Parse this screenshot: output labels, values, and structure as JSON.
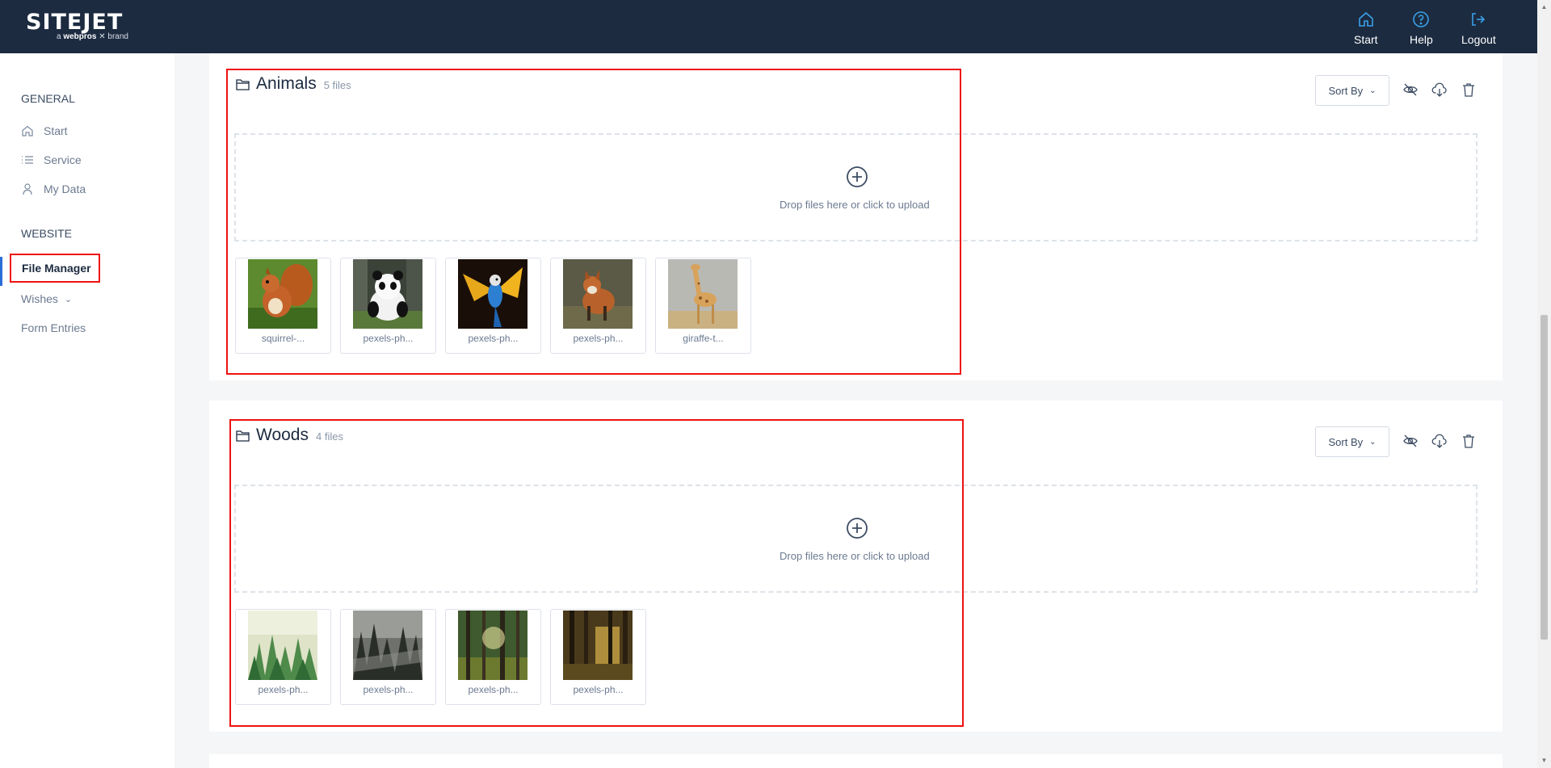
{
  "header": {
    "logo_text": "SITEJET",
    "logo_tag_prefix": "a",
    "logo_tag_brand": "webpros",
    "logo_tag_suffix": "brand",
    "nav": [
      {
        "label": "Start",
        "icon": "home-icon"
      },
      {
        "label": "Help",
        "icon": "question-circle-icon"
      },
      {
        "label": "Logout",
        "icon": "logout-icon"
      }
    ]
  },
  "sidebar": {
    "general_title": "GENERAL",
    "general_items": [
      {
        "label": "Start",
        "icon": "home-icon"
      },
      {
        "label": "Service",
        "icon": "list-icon"
      },
      {
        "label": "My Data",
        "icon": "user-icon"
      }
    ],
    "website_title": "WEBSITE",
    "website_items": [
      {
        "label": "File Manager",
        "active": true
      },
      {
        "label": "Wishes",
        "has_dropdown": true
      },
      {
        "label": "Form Entries"
      }
    ]
  },
  "folders": [
    {
      "name": "Animals",
      "count": "5 files",
      "sort_label": "Sort By",
      "dropzone_text": "Drop files here or click to upload",
      "files": [
        {
          "caption": "squirrel-...",
          "subject": "squirrel"
        },
        {
          "caption": "pexels-ph...",
          "subject": "panda"
        },
        {
          "caption": "pexels-ph...",
          "subject": "parrot"
        },
        {
          "caption": "pexels-ph...",
          "subject": "fox"
        },
        {
          "caption": "giraffe-t...",
          "subject": "giraffe"
        }
      ]
    },
    {
      "name": "Woods",
      "count": "4 files",
      "sort_label": "Sort By",
      "dropzone_text": "Drop files here or click to upload",
      "files": [
        {
          "caption": "pexels-ph...",
          "subject": "misty-pines"
        },
        {
          "caption": "pexels-ph...",
          "subject": "foggy-forest"
        },
        {
          "caption": "pexels-ph...",
          "subject": "sunlit-forest"
        },
        {
          "caption": "pexels-ph...",
          "subject": "golden-forest"
        }
      ]
    }
  ],
  "colors": {
    "header_bg": "#1c2b40",
    "highlight_red": "#ee1111",
    "active_accent": "#2b6dd6"
  }
}
